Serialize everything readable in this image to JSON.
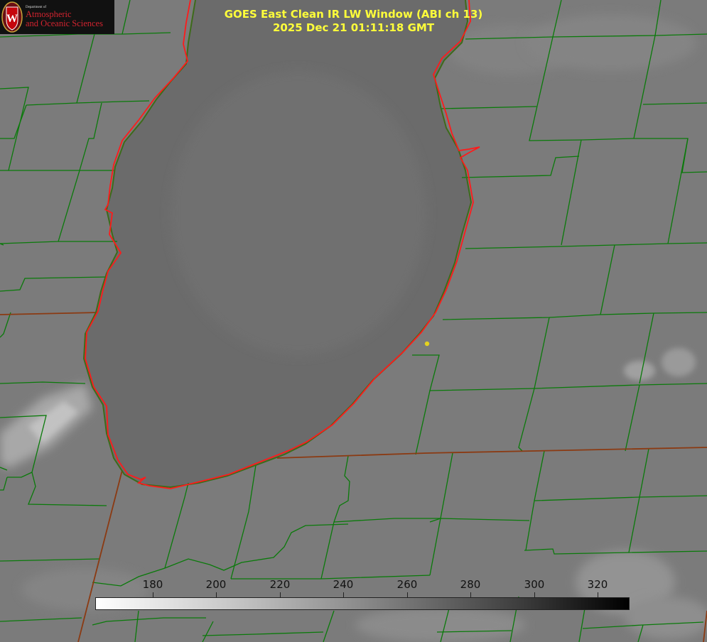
{
  "logo": {
    "department": "Department of",
    "line1": "Atmospheric",
    "line2": "and Oceanic Sciences",
    "seal_letter": "W"
  },
  "title": {
    "line1": "GOES East Clean IR LW Window (ABI ch 13)",
    "line2": "2025 Dec 21 01:11:18 GMT"
  },
  "colorbar": {
    "ticks": [
      "180",
      "200",
      "220",
      "240",
      "260",
      "280",
      "300",
      "320"
    ],
    "range": [
      164,
      333
    ],
    "colormap": "white-to-black grayscale"
  },
  "colors": {
    "title": "#ffff3a",
    "county_lines": "#008000",
    "state_lines": "#8b4513",
    "shoreline": "#ff1a1a",
    "marker": "#e5d21e",
    "lake": "#6c6c6c",
    "land": "#7a7a7a"
  }
}
